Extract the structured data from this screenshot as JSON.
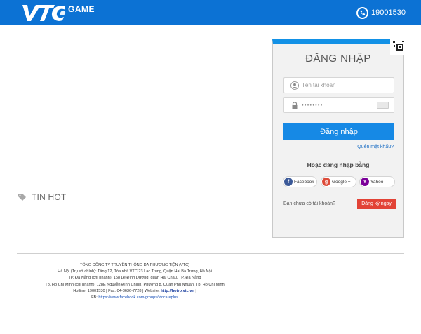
{
  "header": {
    "logo_text": "VTC GAME",
    "hotline": "19001530",
    "icons": {
      "phone": "phone-icon"
    },
    "colors": {
      "bar": "#0c72d4"
    }
  },
  "news": {
    "title": "TIN HOT",
    "icon": "tag-icon"
  },
  "login": {
    "title": "ĐĂNG NHẬP",
    "username_placeholder": "Tên tài khoản",
    "password_value": "••••••••",
    "submit_label": "Đăng nhập",
    "forgot_label": "Quên mật khẩu?",
    "or_label": "Hoặc đăng nhập bằng",
    "social": {
      "facebook": "Facebook",
      "google": "Google +",
      "yahoo": "Yahoo"
    },
    "signup_question": "Bạn chưa có tài khoản?",
    "signup_label": "Đăng ký ngay",
    "colors": {
      "accent": "#1689e5",
      "signup": "#e24336",
      "top_border": "#1291e6"
    }
  },
  "footer": {
    "company": "TỔNG CÔNG TY TRUYỀN THÔNG ĐA PHƯƠNG TIỆN (VTC)",
    "line_hanoi": "Hà Nội (Trụ sở chính): Tầng 12, Tòa nhà VTC 23 Lạc Trung, Quận Hai Bà Trưng, Hà Nội",
    "line_danang": "TP. Đà Nẵng (chi nhánh): 158 Lê Đình Dương, quận Hải Châu, TP. Đà Nẵng",
    "line_hcm": "Tp. Hồ Chí Minh (chi nhánh): 128E Nguyễn Đình Chính, Phường 8, Quận Phú Nhuận, Tp. Hồ Chí Minh",
    "hotline_text": "Hotline: 19001530 | Fax: 04-3636-7728 | Website: ",
    "website": "http://hotro.vtc.vn",
    "website_suffix": " |",
    "fb_prefix": "FB: ",
    "fb_link": "https://www.facebook.com/groups/vtccareplus"
  }
}
